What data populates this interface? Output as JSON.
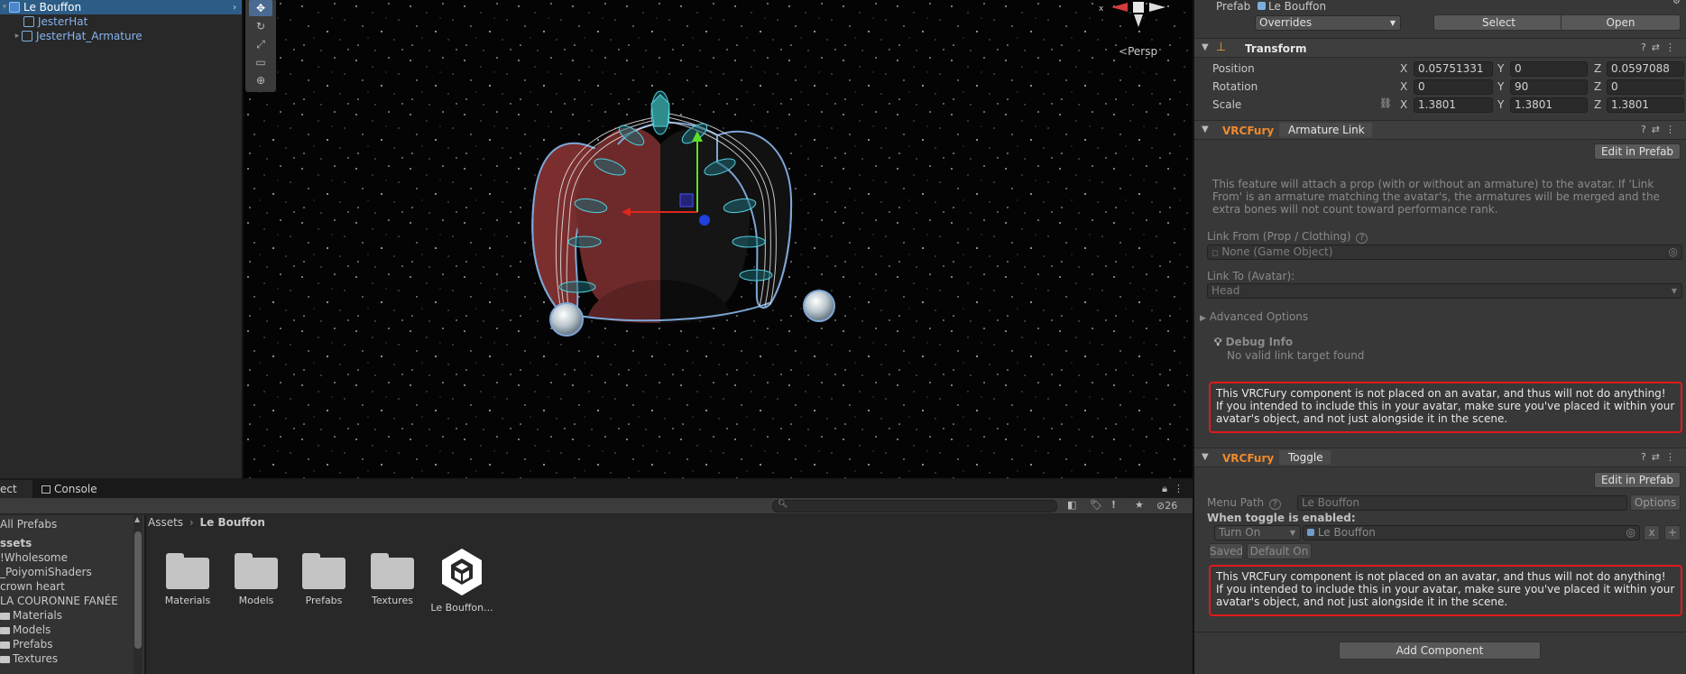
{
  "hierarchy": {
    "items": [
      {
        "label": "Le Bouffon",
        "selected": true
      },
      {
        "label": "JesterHat"
      },
      {
        "label": "JesterHat_Armature"
      }
    ]
  },
  "scene": {
    "persp_label": "Persp",
    "tools": [
      "move-tool",
      "rotate-tool",
      "scale-tool",
      "rect-tool",
      "transform-tool"
    ]
  },
  "inspector": {
    "prefab_label": "Prefab",
    "prefab_name": "Le Bouffon",
    "overrides_value": "Overrides",
    "select_button": "Select",
    "open_button": "Open",
    "transform": {
      "title": "Transform",
      "position_label": "Position",
      "rotation_label": "Rotation",
      "scale_label": "Scale",
      "axis_x": "X",
      "axis_y": "Y",
      "axis_z": "Z",
      "position": {
        "x": "0.05751331",
        "y": "0",
        "z": "0.0597088"
      },
      "rotation": {
        "x": "0",
        "y": "90",
        "z": "0"
      },
      "scale": {
        "x": "1.3801",
        "y": "1.3801",
        "z": "1.3801"
      }
    },
    "armature": {
      "tag": "VRCFury",
      "name": "Armature Link",
      "edit_button": "Edit in Prefab",
      "description": "This feature will attach a prop (with or without an armature) to the avatar. If 'Link From' is an armature matching the avatar's, the armatures will be merged and the extra bones will not count toward performance rank.",
      "link_from_label": "Link From (Prop / Clothing)",
      "link_from_value": "None (Game Object)",
      "link_to_label": "Link To (Avatar):",
      "link_to_value": "Head",
      "advanced_label": "Advanced Options",
      "debug_title": "Debug Info",
      "debug_text": "No valid link target found",
      "warning": "This VRCFury component is not placed on an avatar, and thus will not do anything! If you intended to include this in your avatar, make sure you've placed it within your avatar's object, and not just alongside it in the scene."
    },
    "toggle": {
      "tag": "VRCFury",
      "name": "Toggle",
      "edit_button": "Edit in Prefab",
      "menu_path_label": "Menu Path",
      "menu_path_value": "Le Bouffon",
      "options_button": "Options",
      "when_enabled_label": "When toggle is enabled:",
      "action_value": "Turn On",
      "target_value": "Le Bouffon",
      "x_button": "x",
      "plus_button": "+",
      "saved_button": "Saved",
      "default_on_button": "Default On",
      "warning": "This VRCFury component is not placed on an avatar, and thus will not do anything! If you intended to include this in your avatar, make sure you've placed it within your avatar's object, and not just alongside it in the scene."
    },
    "add_component_button": "Add Component"
  },
  "project": {
    "tab_project": "ect",
    "tab_console": "Console",
    "hidden_count": "26",
    "tree": [
      {
        "label": "All Prefabs",
        "kind": "search"
      },
      {
        "label": "ssets",
        "kind": "root"
      },
      {
        "label": "!Wholesome",
        "kind": "item"
      },
      {
        "label": "_PoiyomiShaders",
        "kind": "item"
      },
      {
        "label": "crown heart",
        "kind": "item"
      },
      {
        "label": "LA COURONNE FANÉE",
        "kind": "item"
      },
      {
        "label": "Materials",
        "kind": "folder"
      },
      {
        "label": "Models",
        "kind": "folder"
      },
      {
        "label": "Prefabs",
        "kind": "folder"
      },
      {
        "label": "Textures",
        "kind": "folder"
      }
    ],
    "breadcrumb": [
      "Assets",
      "Le Bouffon"
    ],
    "assets": [
      {
        "label": "Materials",
        "type": "folder"
      },
      {
        "label": "Models",
        "type": "folder"
      },
      {
        "label": "Prefabs",
        "type": "folder"
      },
      {
        "label": "Textures",
        "type": "folder"
      },
      {
        "label": "Le Bouffon...",
        "type": "unity-package"
      }
    ]
  },
  "colors": {
    "selection": "#2c5d87",
    "vrcfury_orange": "#f08a2c",
    "warning_border": "#e01a1a",
    "hat_red": "#7a2e2e",
    "hat_black": "#161616"
  }
}
